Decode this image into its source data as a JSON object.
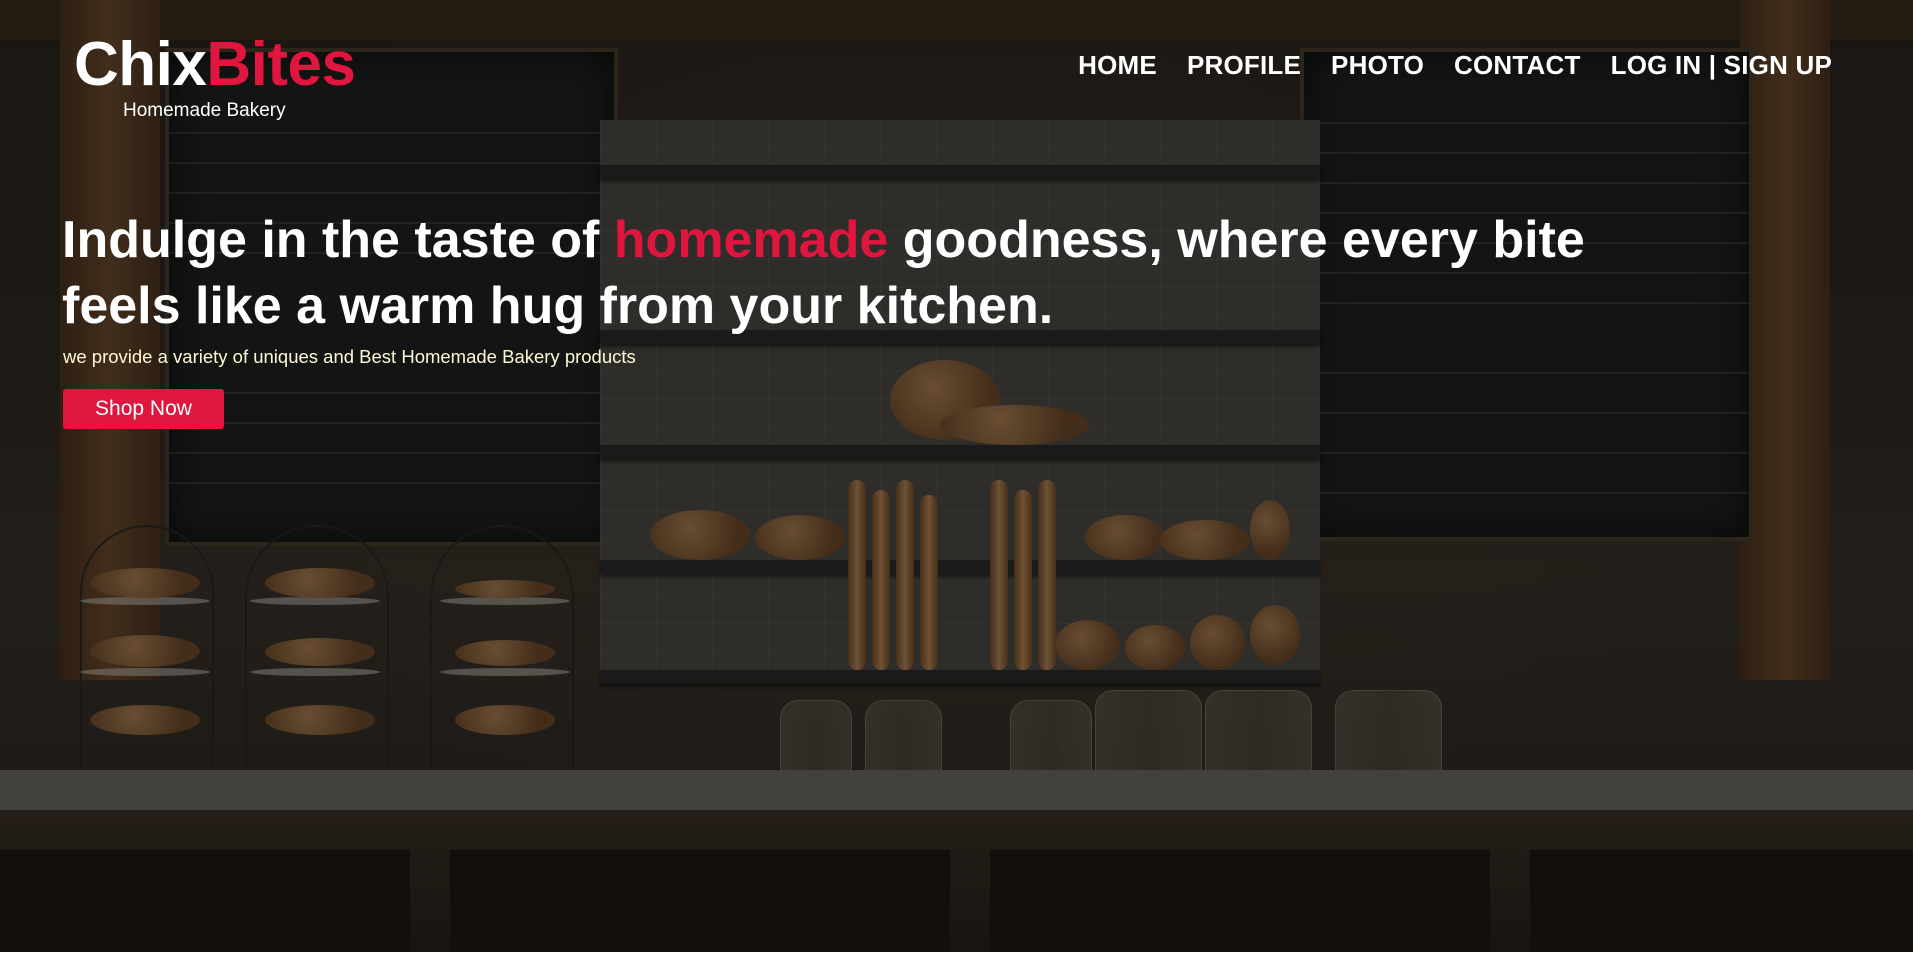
{
  "brand": {
    "name_part1": "Chix",
    "name_part2": "Bites",
    "tagline": "Homemade Bakery",
    "accent_color": "#e0163f"
  },
  "nav": {
    "items": [
      {
        "label": "HOME"
      },
      {
        "label": "PROFILE"
      },
      {
        "label": "PHOTO"
      },
      {
        "label": "CONTACT"
      },
      {
        "label": "LOG IN | SIGN UP"
      }
    ]
  },
  "hero": {
    "headline_before": "Indulge in the taste of ",
    "headline_accent": "homemade",
    "headline_after": " goodness, where every bite feels like a warm hug from your kitchen.",
    "subtext": "we provide a variety of uniques and Best Homemade Bakery products",
    "cta_label": "Shop Now",
    "background_image": "bakery-counter-photo"
  }
}
